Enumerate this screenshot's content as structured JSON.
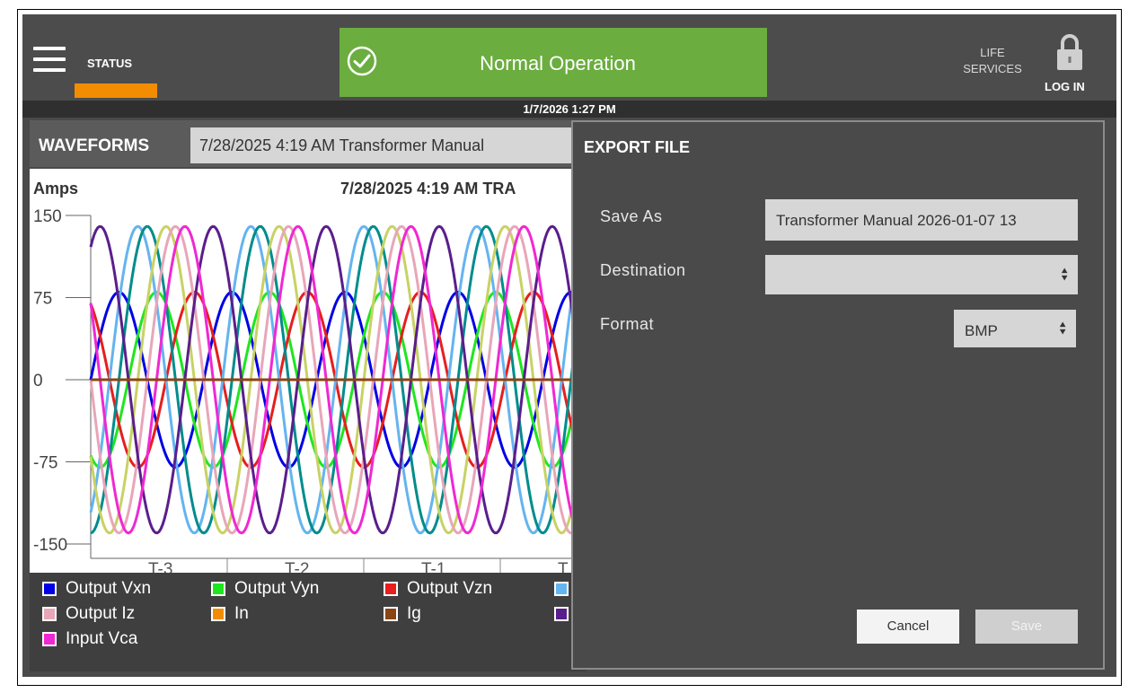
{
  "topbar": {
    "status_label": "STATUS",
    "banner_text": "Normal Operation",
    "life_services": "LIFE SERVICES",
    "login_label": "LOG IN",
    "datetime": "1/7/2026 1:27 PM"
  },
  "waveforms": {
    "title": "WAVEFORMS",
    "selected_event": "7/28/2025 4:19 AM Transformer Manual",
    "chart_title": "7/28/2025 4:19 AM TRA",
    "legend": [
      {
        "label": "Output Vxn",
        "color": "#0000e6"
      },
      {
        "label": "Output Vyn",
        "color": "#1ee61e"
      },
      {
        "label": "Output Vzn",
        "color": "#e61e1e"
      },
      {
        "label": "",
        "color": "#64b4f0"
      },
      {
        "label": "Output Iz",
        "color": "#e8a6b8"
      },
      {
        "label": "In",
        "color": "#f28c00"
      },
      {
        "label": "Ig",
        "color": "#8b4513"
      },
      {
        "label": "",
        "color": "#5a1e8c"
      },
      {
        "label": "Input Vca",
        "color": "#f028d2"
      }
    ]
  },
  "chart_data": {
    "type": "line",
    "ylabel": "Amps",
    "ylim": [
      -150,
      150
    ],
    "yticks": [
      150,
      75,
      0,
      -75,
      -150
    ],
    "x_tick_labels": [
      "T-3",
      "T-2",
      "T-1",
      "T"
    ],
    "series": [
      {
        "name": "Output Vxn",
        "color": "#0000e6",
        "amplitude": 80,
        "phase_deg": 0
      },
      {
        "name": "Output Vyn",
        "color": "#1ee61e",
        "amplitude": 80,
        "phase_deg": 240
      },
      {
        "name": "Output Vzn",
        "color": "#e61e1e",
        "amplitude": 80,
        "phase_deg": 120
      },
      {
        "name": "",
        "color": "#64b4f0",
        "amplitude": 140,
        "phase_deg": 300
      },
      {
        "name": "",
        "color": "#008c8c",
        "amplitude": 140,
        "phase_deg": 270
      },
      {
        "name": "",
        "color": "#c8d264",
        "amplitude": 140,
        "phase_deg": 210
      },
      {
        "name": "Output Iz",
        "color": "#e8a6b8",
        "amplitude": 140,
        "phase_deg": 180
      },
      {
        "name": "",
        "color": "#5a1e8c",
        "amplitude": 140,
        "phase_deg": 60
      },
      {
        "name": "Input Vca",
        "color": "#f028d2",
        "amplitude": 140,
        "phase_deg": 150
      },
      {
        "name": "In",
        "color": "#f28c00",
        "amplitude": 0,
        "phase_deg": 0
      },
      {
        "name": "Ig",
        "color": "#8b4513",
        "amplitude": 0,
        "phase_deg": 0
      }
    ],
    "cycles_visible": 4,
    "grid": false
  },
  "dialog": {
    "title": "EXPORT FILE",
    "save_as_label": "Save As",
    "save_as_value": "Transformer Manual 2026-01-07 13",
    "destination_label": "Destination",
    "destination_value": "",
    "format_label": "Format",
    "format_value": "BMP",
    "cancel_label": "Cancel",
    "save_label": "Save"
  }
}
